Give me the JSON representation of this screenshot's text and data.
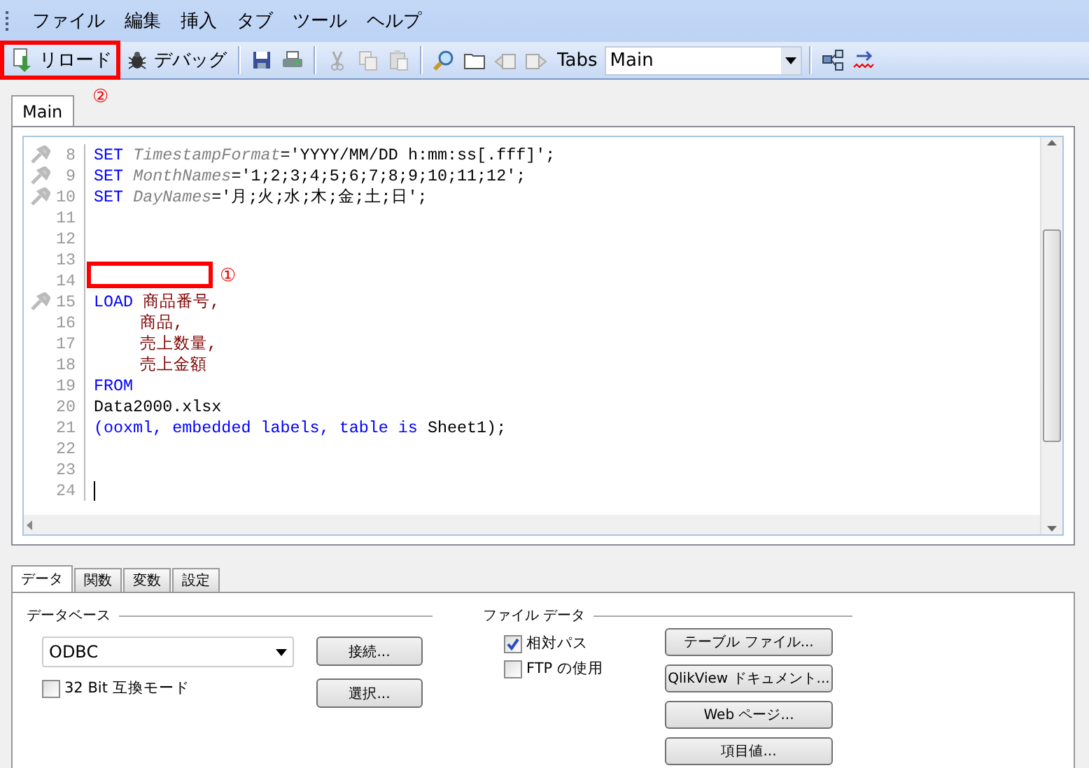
{
  "menu": [
    {
      "label": "ファイル"
    },
    {
      "label": "編集"
    },
    {
      "label": "挿入"
    },
    {
      "label": "タブ"
    },
    {
      "label": "ツール"
    },
    {
      "label": "ヘルプ"
    }
  ],
  "toolbar": {
    "reload": "リロード",
    "debug": "デバッグ",
    "tabs_label": "Tabs",
    "tabs_value": "Main",
    "reload_callout": "②"
  },
  "editor_tabs": [
    {
      "label": "Main",
      "selected": true
    }
  ],
  "code_lines": [
    {
      "number": "8",
      "marker": true,
      "tokens": [
        {
          "kind": "kw",
          "text": "SET "
        },
        {
          "kind": "var",
          "text": "TimestampFormat"
        },
        {
          "kind": "plain",
          "text": "='YYYY/MM/DD h:mm:ss[.fff]';"
        }
      ]
    },
    {
      "number": "9",
      "marker": true,
      "tokens": [
        {
          "kind": "kw",
          "text": "SET "
        },
        {
          "kind": "var",
          "text": "MonthNames"
        },
        {
          "kind": "plain",
          "text": "='1;2;3;4;5;6;7;8;9;10;11;12';"
        }
      ]
    },
    {
      "number": "10",
      "marker": true,
      "tokens": [
        {
          "kind": "kw",
          "text": "SET "
        },
        {
          "kind": "var",
          "text": "DayNames"
        },
        {
          "kind": "plain",
          "text": "='月;火;水;木;金;土;日';"
        }
      ]
    },
    {
      "number": "11",
      "marker": false
    },
    {
      "number": "12",
      "marker": false
    },
    {
      "number": "13",
      "marker": false
    },
    {
      "number": "14",
      "marker": false,
      "callout": "①"
    },
    {
      "number": "15",
      "marker": true,
      "tokens": [
        {
          "kind": "kw",
          "text": "LOAD "
        },
        {
          "kind": "field",
          "text": "商品番号,"
        }
      ]
    },
    {
      "number": "16",
      "marker": false,
      "tokens": [
        {
          "kind": "indent"
        },
        {
          "kind": "field",
          "text": "商品,"
        }
      ]
    },
    {
      "number": "17",
      "marker": false,
      "tokens": [
        {
          "kind": "indent"
        },
        {
          "kind": "field",
          "text": "売上数量,"
        }
      ]
    },
    {
      "number": "18",
      "marker": false,
      "tokens": [
        {
          "kind": "indent"
        },
        {
          "kind": "field",
          "text": "売上金額"
        }
      ]
    },
    {
      "number": "19",
      "marker": false,
      "tokens": [
        {
          "kind": "kw",
          "text": "FROM"
        }
      ]
    },
    {
      "number": "20",
      "marker": false,
      "tokens": [
        {
          "kind": "plain",
          "text": "Data2000.xlsx"
        }
      ]
    },
    {
      "number": "21",
      "marker": false,
      "tokens": [
        {
          "kind": "kw",
          "text": "(ooxml, embedded labels, table is "
        },
        {
          "kind": "plain",
          "text": "Sheet1);"
        }
      ]
    },
    {
      "number": "22",
      "marker": false
    },
    {
      "number": "23",
      "marker": false
    },
    {
      "number": "24",
      "marker": false,
      "caret": true
    }
  ],
  "bottom_tabs": [
    {
      "label": "データ",
      "selected": true
    },
    {
      "label": "関数",
      "selected": false
    },
    {
      "label": "変数",
      "selected": false
    },
    {
      "label": "設定",
      "selected": false
    }
  ],
  "database": {
    "title": "データベース",
    "driver": "ODBC",
    "options": [
      {
        "label": "32 Bit 互換モード",
        "checked": false
      }
    ],
    "buttons": [
      "接続...",
      "選択..."
    ]
  },
  "file_data": {
    "title": "ファイル データ",
    "options": [
      {
        "label": "相対パス",
        "checked": true
      },
      {
        "label": "FTP の使用",
        "checked": false
      }
    ],
    "buttons": [
      "テーブル ファイル...",
      "QlikView ドキュメント...",
      "Web ページ...",
      "項目値..."
    ]
  }
}
